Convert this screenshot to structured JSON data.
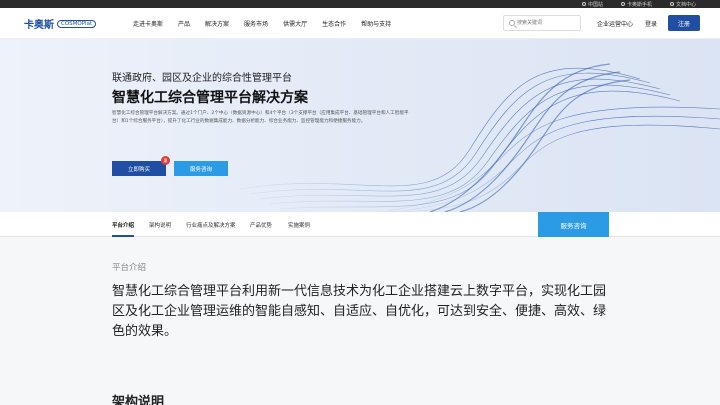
{
  "topbar": {
    "region": "中国站",
    "app": "卡奥斯手机",
    "docs": "文档中心"
  },
  "header": {
    "logo_cn": "卡奥斯",
    "logo_en": "COSMOPlat",
    "nav": [
      "走进卡奥斯",
      "产品",
      "解决方案",
      "服务市场",
      "供需大厅",
      "生态合作",
      "帮助与支持"
    ],
    "search_placeholder": "搜索关键词",
    "enterprise_center": "企业运营中心",
    "login": "登录",
    "register": "注册"
  },
  "hero": {
    "subtitle": "联通政府、园区及企业的综合性管理平台",
    "title": "智慧化工综合管理平台解决方案",
    "description": "智慧化工综合管理平台解决方案。通过1个门户、2个中心（数据资源中心）和4个平台（3个支撑平台（应用集成平台、基础管理平台和人工智能平台）和1个综合服务平台），提升了化工行业的数据集成能力、数据分析能力、综合业务能力、监控管理能力和便捷服务能力。",
    "buy_label": "立即购买",
    "buy_badge": "惠",
    "consult_label": "服务咨询"
  },
  "subnav": {
    "tabs": [
      "平台介绍",
      "架构说明",
      "行业痛点及解决方案",
      "产品优势",
      "实施案例"
    ],
    "consult_label": "服务咨询"
  },
  "content": {
    "section_label": "平台介绍",
    "body": "智慧化工综合管理平台利用新一代信息技术为化工企业搭建云上数字平台，实现化工园区及化工企业管理运维的智能自感知、自适应、自优化，可达到安全、便捷、高效、绿色的效果。",
    "next_section": "架构说明"
  },
  "colors": {
    "brand": "#1f4ea3",
    "accent": "#2c9be5",
    "badge": "#e23b3b"
  }
}
